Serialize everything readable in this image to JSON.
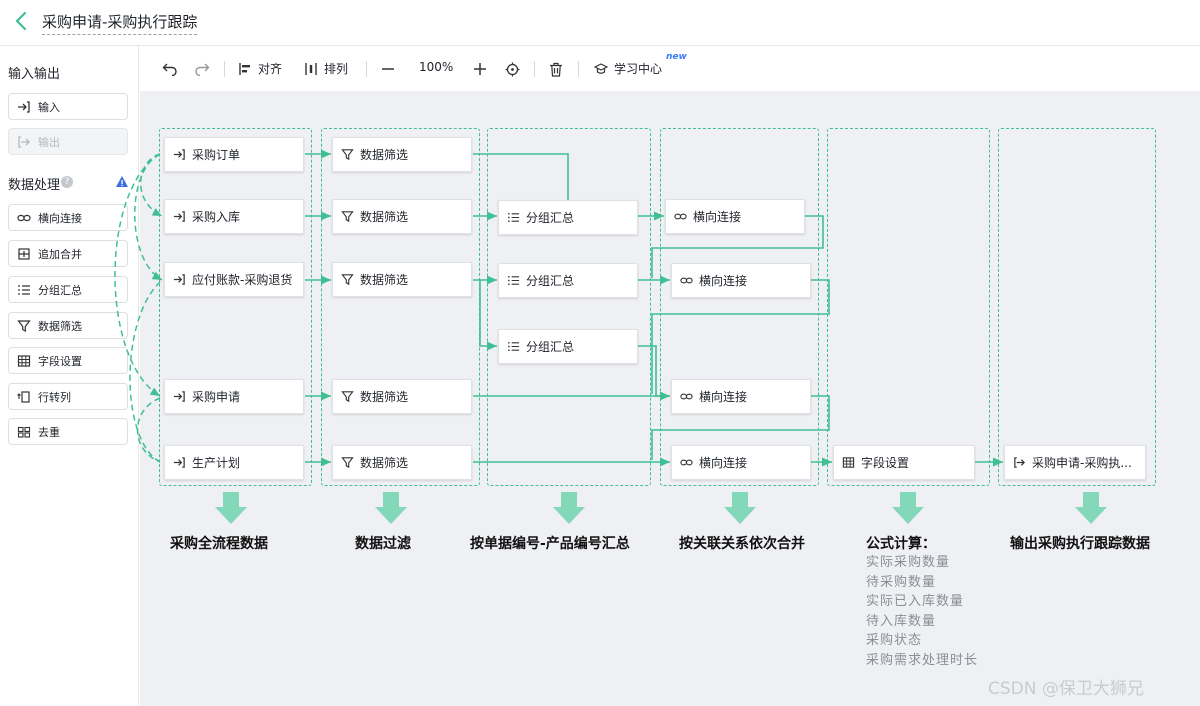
{
  "title": "采购申请-采购执行跟踪",
  "sidebar": {
    "io_title": "输入输出",
    "io_items": [
      {
        "label": "输入",
        "icon": "input-icon"
      },
      {
        "label": "输出",
        "icon": "output-icon",
        "disabled": true
      }
    ],
    "proc_title": "数据处理",
    "proc_items": [
      {
        "label": "横向连接",
        "icon": "link-icon"
      },
      {
        "label": "追加合并",
        "icon": "append-merge-icon"
      },
      {
        "label": "分组汇总",
        "icon": "list-icon"
      },
      {
        "label": "数据筛选",
        "icon": "filter-icon"
      },
      {
        "label": "字段设置",
        "icon": "table-icon"
      },
      {
        "label": "行转列",
        "icon": "row-to-column-icon"
      },
      {
        "label": "去重",
        "icon": "dedupe-icon"
      }
    ]
  },
  "toolbar": {
    "align_label": "对齐",
    "arrange_label": "排列",
    "zoom": "100%",
    "learning_label": "学习中心",
    "new_badge": "new"
  },
  "nodes": {
    "inputs": [
      "采购订单",
      "采购入库",
      "应付账款-采购退货",
      "采购申请",
      "生产计划"
    ],
    "filter_label": "数据筛选",
    "group_label": "分组汇总",
    "join_label": "横向连接",
    "field_label": "字段设置",
    "output_label": "采购申请-采购执..."
  },
  "captions": [
    "采购全流程数据",
    "数据过滤",
    "按单据编号-产品编号汇总",
    "按关联关系依次合并",
    "公式计算：",
    "输出采购执行跟踪数据"
  ],
  "formula_lines": [
    "实际采购数量",
    "待采购数量",
    "实际已入库数量",
    "待入库数量",
    "采购状态",
    "采购需求处理时长"
  ],
  "watermark": "CSDN @保卫大狮兄",
  "colors": {
    "accent": "#3fbf92",
    "canvas": "#eff0f3"
  }
}
